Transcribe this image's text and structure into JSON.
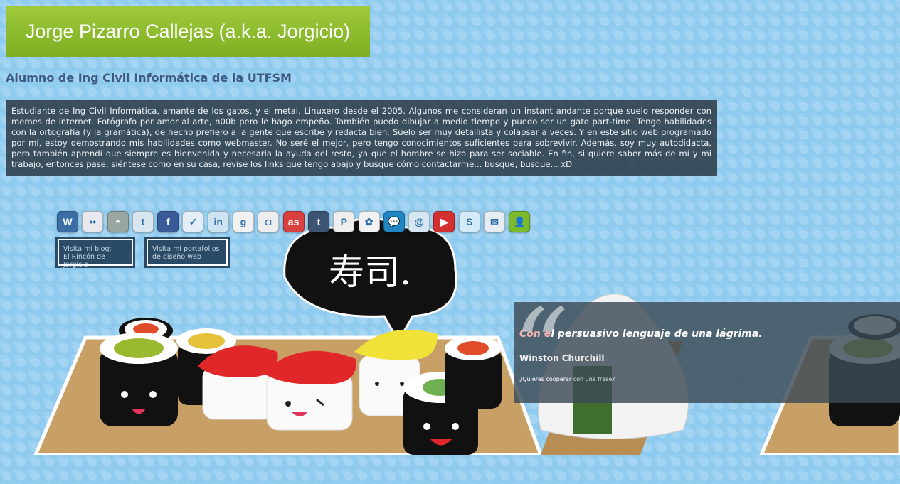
{
  "header": {
    "title": "Jorge Pizarro Callejas (a.k.a. Jorgicio)",
    "subtitle": "Alumno de Ing Civil Informática de la UTFSM"
  },
  "bio": {
    "text": "Estudiante de Ing Civil Informática, amante de los gatos, y el metal. Linuxero desde el 2005. Algunos me consideran un instant andante porque suelo responder con memes de internet. Fotógrafo por amor al arte, n00b pero le hago empeño. También puedo dibujar a medio tiempo y puedo ser un gato part-time. Tengo habilidades con la ortografía (y la gramática), de hecho prefiero a la gente que escribe y redacta bien. Suelo ser muy detallista y colapsar a veces. Y en este sitio web programado por mí, estoy demostrando mis habilidades como webmaster. No seré el mejor, pero tengo conocimientos suficientes para sobrevivir. Además, soy muy autodidacta, pero también aprendí que siempre es bienvenida y necesaria la ayuda del resto, ya que el hombre se hizo para ser sociable. En fin, si quiere saber más de mí y mi trabajo, entonces pase, siéntese como en su casa, revise los links que tengo abajo y busque cómo contactarme... busque, busque... xD"
  },
  "social_icons": [
    {
      "name": "wordpress-icon",
      "color": "#3a6ea5",
      "glyph": "W"
    },
    {
      "name": "flickr-icon",
      "color": "#e8e8ee",
      "glyph": "••"
    },
    {
      "name": "delicious-icon",
      "color": "#9aa7a0",
      "glyph": "◓"
    },
    {
      "name": "twitter-icon",
      "color": "#d8e6ef",
      "glyph": "t"
    },
    {
      "name": "facebook-icon",
      "color": "#3b5b98",
      "glyph": "f"
    },
    {
      "name": "foursquare-icon",
      "color": "#e3eef6",
      "glyph": "✓"
    },
    {
      "name": "linkedin-icon",
      "color": "#cfe4f2",
      "glyph": "in"
    },
    {
      "name": "google-icon",
      "color": "#f2f2f2",
      "glyph": "g"
    },
    {
      "name": "squarespace-icon",
      "color": "#eeeeee",
      "glyph": "◘"
    },
    {
      "name": "lastfm-icon",
      "color": "#d9413e",
      "glyph": "as"
    },
    {
      "name": "tumblr-icon",
      "color": "#3b5573",
      "glyph": "t"
    },
    {
      "name": "plurk-icon",
      "color": "#eeeeee",
      "glyph": "P"
    },
    {
      "name": "msn-icon",
      "color": "#f2f2f2",
      "glyph": "✿"
    },
    {
      "name": "chat-icon",
      "color": "#1f86c2",
      "glyph": "💬"
    },
    {
      "name": "identica-icon",
      "color": "#d5e7f2",
      "glyph": "@"
    },
    {
      "name": "youtube-icon",
      "color": "#d53030",
      "glyph": "▶"
    },
    {
      "name": "skype-icon",
      "color": "#d4ecf9",
      "glyph": "S"
    },
    {
      "name": "email-icon",
      "color": "#e6eef4",
      "glyph": "✉"
    },
    {
      "name": "contact-icon",
      "color": "#7bbb2a",
      "glyph": "👤"
    }
  ],
  "buttons": {
    "blog": "Visita mi blog:\nEl Rincón de Jorgicio",
    "portfolio": "Visita mi portafolios\nde diseño web"
  },
  "quote": {
    "first": "Con e",
    "rest": "l persuasivo lenguaje de una lágrima.",
    "author": "Winston Churchill",
    "link_text": "¿Quieres cooperar",
    "link_suffix": " con una frase?"
  },
  "scene": {
    "kanji": "寿司."
  }
}
